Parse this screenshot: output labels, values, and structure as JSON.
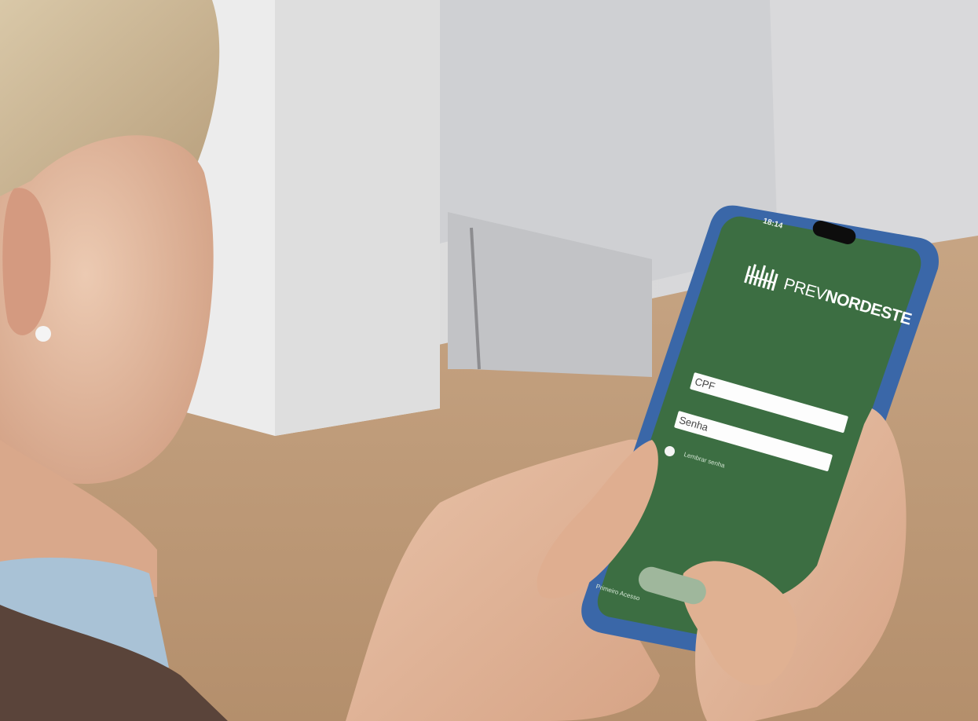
{
  "phone": {
    "status_time": "18:14",
    "brand": {
      "light": "PREV",
      "bold": "NORDESTE"
    },
    "fields": [
      {
        "label": "CPF"
      },
      {
        "label": "Senha"
      }
    ],
    "remember_label": "Lembrar senha",
    "first_access_label": "Primeiro Acesso",
    "login_button_label": "",
    "screen_color": "#3c6e42",
    "case_color": "#3a67a8"
  }
}
